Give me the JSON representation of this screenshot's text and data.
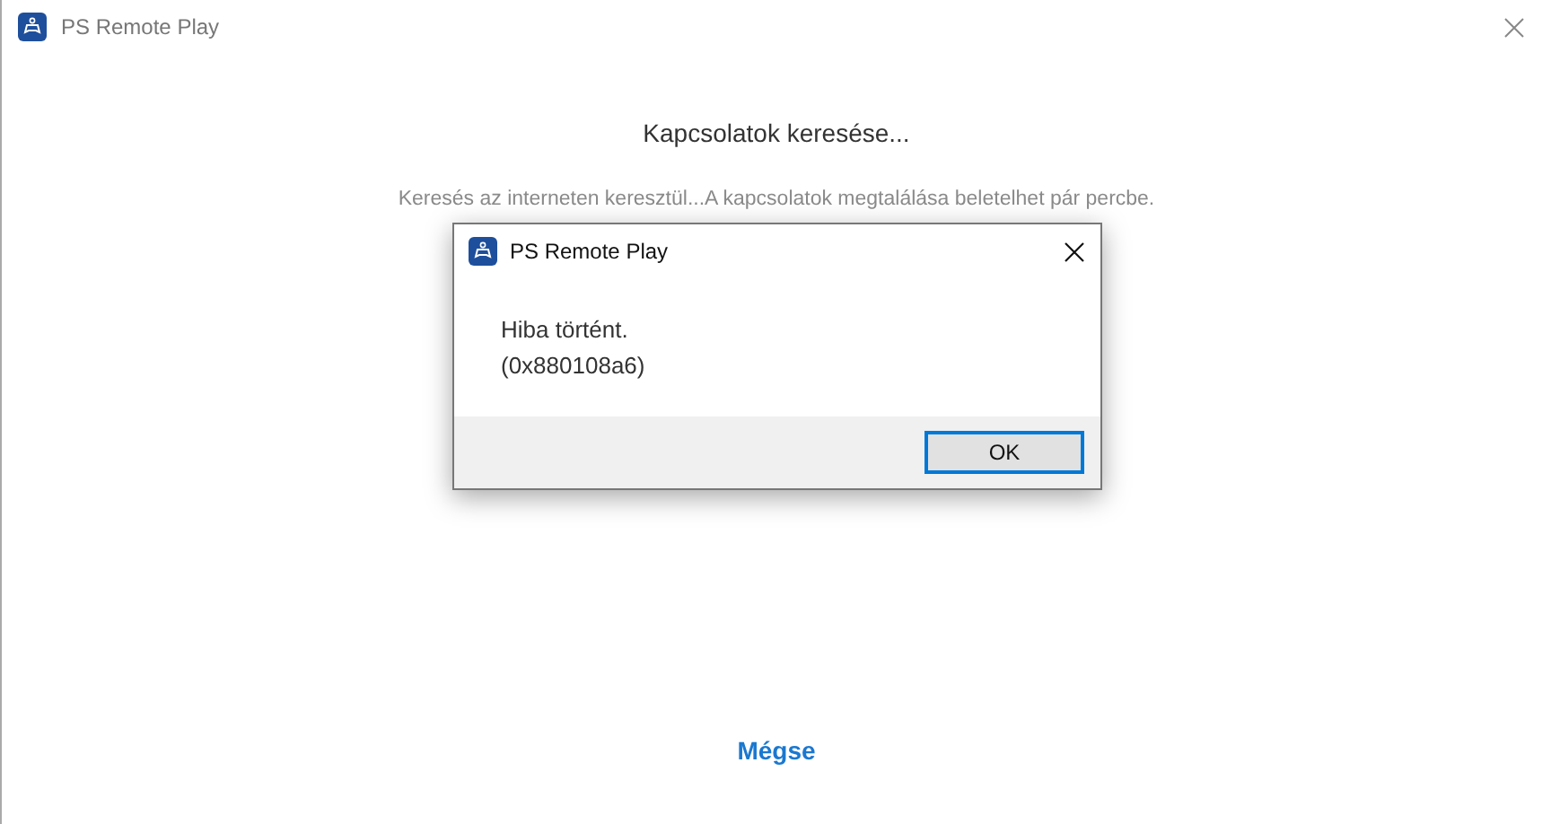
{
  "window": {
    "title": "PS Remote Play"
  },
  "heading": "Kapcsolatok keresése...",
  "subtitle": "Keresés az interneten keresztül...A kapcsolatok megtalálása beletelhet pár percbe.",
  "cancel": "Mégse",
  "dialog": {
    "title": "PS Remote Play",
    "message": "Hiba történt.",
    "code": "(0x880108a6)",
    "button": "OK"
  }
}
